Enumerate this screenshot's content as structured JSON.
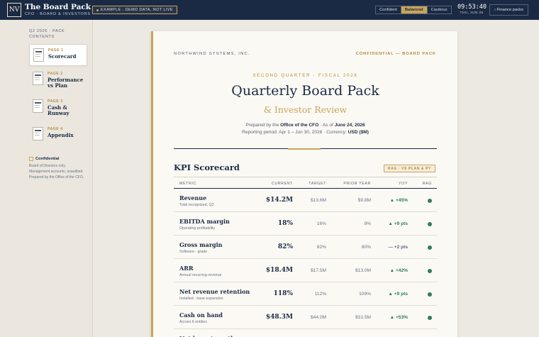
{
  "app": {
    "logo": "NV",
    "title": "The Board Pack",
    "subtitle": "CFO · BOARD & INVESTORS",
    "demo_badge": "EXAMPLE · DEMO DATA, NOT LIVE"
  },
  "tone": {
    "options": [
      "Confident",
      "Balanced",
      "Cautious"
    ],
    "selected": "Balanced"
  },
  "clock": {
    "time": "09:53:40",
    "date": "THU, JUN 25"
  },
  "back_button": "‹ Finance packs",
  "sidebar": {
    "heading": "Q2 2026 · PACK CONTENTS",
    "pages": [
      {
        "num": "PAGE 1",
        "label": "Scorecard",
        "active": true
      },
      {
        "num": "PAGE 2",
        "label": "Performance vs Plan",
        "active": false
      },
      {
        "num": "PAGE 3",
        "label": "Cash & Runway",
        "active": false
      },
      {
        "num": "PAGE 4",
        "label": "Appendix",
        "active": false
      }
    ],
    "confidential_title": "Confidential",
    "confidential_text": "Board of Directors only. Management accounts, unaudited. Prepared by the Office of the CFO."
  },
  "doc": {
    "company": "NORTHWIND SYSTEMS, INC.",
    "confidential": "CONFIDENTIAL — BOARD PACK",
    "kicker": "SECOND QUARTER · FISCAL 2026",
    "title": "Quarterly Board Pack",
    "subtitle": "& Investor Review",
    "prepared_by_prefix": "Prepared by the",
    "prepared_by": "Office of the CFO",
    "as_of_prefix": "· As of",
    "as_of": "June 24, 2026",
    "period_prefix": "Reporting period:",
    "period": "Apr 1 – Jun 30, 2026",
    "currency_prefix": "· Currency:",
    "currency": "USD ($M)"
  },
  "kpi": {
    "title": "KPI Scorecard",
    "badge": "RAG · VS PLAN & PY",
    "columns": {
      "metric": "METRIC",
      "current": "CURRENT",
      "target": "TARGET",
      "prior": "PRIOR YEAR",
      "yoy": "YOY",
      "rag": "RAG"
    },
    "rows": [
      {
        "name": "Revenue",
        "desc": "Total recognized, Q2",
        "current": "$14.2M",
        "target": "$13.6M",
        "prior": "$9.8M",
        "yoy": "▲ +45%",
        "yoy_tone": "up",
        "rag": "green"
      },
      {
        "name": "EBITDA margin",
        "desc": "Operating profitability",
        "current": "18%",
        "target": "16%",
        "prior": "9%",
        "yoy": "▲ +9 pts",
        "yoy_tone": "up",
        "rag": "green"
      },
      {
        "name": "Gross margin",
        "desc": "Software - grade",
        "current": "82%",
        "target": "82%",
        "prior": "80%",
        "yoy": "— +2 pts",
        "yoy_tone": "neutral",
        "rag": "green"
      },
      {
        "name": "ARR",
        "desc": "Annual recurring revenue",
        "current": "$18.4M",
        "target": "$17.5M",
        "prior": "$13.0M",
        "yoy": "▲ +42%",
        "yoy_tone": "up",
        "rag": "green"
      },
      {
        "name": "Net revenue retention",
        "desc": "Installed - base expansion",
        "current": "118%",
        "target": "112%",
        "prior": "109%",
        "yoy": "▲ +9 pts",
        "yoy_tone": "up",
        "rag": "green"
      },
      {
        "name": "Cash on hand",
        "desc": "Across 6 entities",
        "current": "$48.3M",
        "target": "$44.0M",
        "prior": "$31.5M",
        "yoy": "▲ +53%",
        "yoy_tone": "up",
        "rag": "green"
      },
      {
        "name": "Net burn / month",
        "desc": "",
        "current": "",
        "target": "",
        "prior": "",
        "yoy": "",
        "yoy_tone": "up",
        "rag": ""
      }
    ]
  },
  "colors": {
    "navy": "#1b2a44",
    "gold": "#c9a45a",
    "green": "#2e7d5b",
    "paper": "#fbf9f4"
  }
}
